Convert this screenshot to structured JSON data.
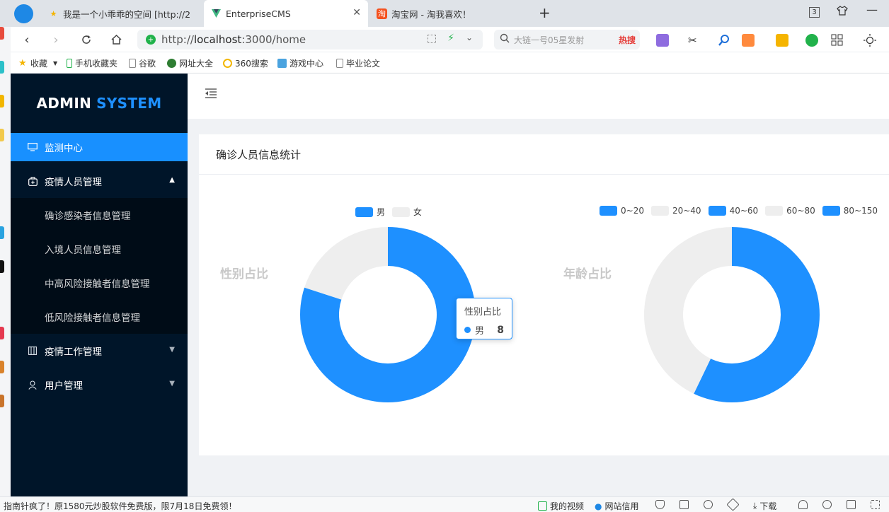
{
  "browser": {
    "tabs": [
      {
        "label": "我是一个小乖乖的空间 [http://2",
        "favicon": "star-icon"
      },
      {
        "label": "EnterpriseCMS",
        "favicon": "vue-icon",
        "active": true
      },
      {
        "label": "淘宝网 - 淘我喜欢！",
        "favicon": "taobao-icon"
      }
    ],
    "tab_count": "3",
    "url_prefix": "http://",
    "url_host": "localhost",
    "url_rest": ":3000/home",
    "search_placeholder": "大链一号05星发射",
    "search_hot": "热搜",
    "bookmarks": [
      "收藏",
      "手机收藏夹",
      "谷歌",
      "网址大全",
      "360搜索",
      "游戏中心",
      "毕业论文"
    ]
  },
  "app": {
    "logo_main": "ADMIN",
    "logo_accent": "SYSTEM",
    "menu": [
      {
        "label": "监测中心",
        "icon": "monitor-icon"
      },
      {
        "label": "疫情人员管理",
        "icon": "medkit-icon"
      },
      {
        "label": "疫情工作管理",
        "icon": "layout-icon"
      },
      {
        "label": "用户管理",
        "icon": "user-icon"
      }
    ],
    "submenu": [
      "确诊感染者信息管理",
      "入境人员信息管理",
      "中高风险接触者信息管理",
      "低风险接触者信息管理"
    ],
    "card_title": "确诊人员信息统计"
  },
  "chart_data": [
    {
      "type": "pie",
      "title": "性别占比",
      "labels": [
        "男",
        "女"
      ],
      "values": [
        8,
        2
      ],
      "colors": [
        "#1e90ff",
        "#eeeeee"
      ],
      "legend": "top"
    },
    {
      "type": "pie",
      "title": "年龄占比",
      "labels": [
        "0~20",
        "20~40",
        "40~60",
        "60~80",
        "80~150"
      ],
      "values": [
        4,
        0,
        0,
        3,
        0
      ],
      "colors": [
        "#1e90ff",
        "#eeeeee",
        "#1e90ff",
        "#eeeeee",
        "#1e90ff"
      ],
      "legend": "top"
    }
  ],
  "tooltip": {
    "title": "性别占比",
    "label": "男",
    "value": "8",
    "color": "#1e90ff"
  },
  "statusbar": {
    "ad": "指南针疯了！原1580元炒股软件免费版，限7月18日免费领！",
    "video": "我的视频",
    "credit": "网站信用",
    "download": "下载"
  }
}
